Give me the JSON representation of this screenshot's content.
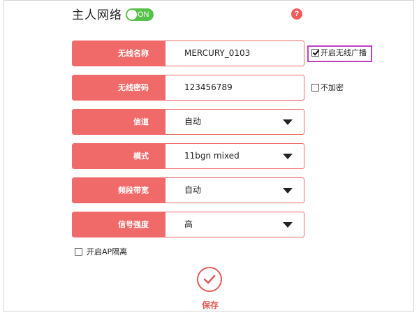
{
  "header": {
    "title": "主人网络",
    "toggle_text": "ON",
    "help_icon": "?"
  },
  "colors": {
    "accent": "#f06a6a",
    "toggle_on": "#57c24a",
    "highlight": "#c03fc0",
    "save": "#e35a5a"
  },
  "form": {
    "ssid": {
      "label": "无线名称",
      "value": "MERCURY_0103"
    },
    "password": {
      "label": "无线密码",
      "value": "123456789"
    },
    "channel": {
      "label": "信道",
      "value": "自动"
    },
    "mode": {
      "label": "模式",
      "value": "11bgn mixed"
    },
    "bandwidth": {
      "label": "频段带宽",
      "value": "自动"
    },
    "signal": {
      "label": "信号强度",
      "value": "高"
    }
  },
  "options": {
    "broadcast": {
      "label": "开启无线广播",
      "checked": true
    },
    "no_encrypt": {
      "label": "不加密",
      "checked": false
    },
    "ap_isolation": {
      "label": "开启AP隔离",
      "checked": false
    }
  },
  "footer": {
    "save_label": "保存"
  },
  "icons": {
    "help": "help-icon",
    "caret": "chevron-down-icon",
    "save": "checkmark-icon"
  }
}
